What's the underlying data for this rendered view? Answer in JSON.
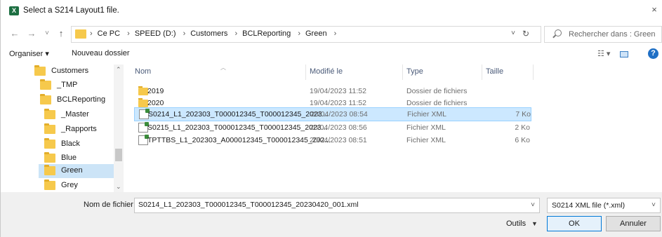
{
  "window": {
    "title": "Select a S214 Layout1 file.",
    "close_glyph": "×"
  },
  "nav": {
    "back_glyph": "←",
    "forward_glyph": "→",
    "recent_glyph": "˅",
    "up_glyph": "↑",
    "address": {
      "crumbs": [
        "Ce PC",
        "SPEED (D:)",
        "Customers",
        "BCLReporting",
        "Green"
      ],
      "separator": "›",
      "dropdown_glyph": "˅"
    },
    "refresh_glyph": "↻",
    "search_placeholder": "Rechercher dans : Green"
  },
  "toolbar": {
    "organiser": "Organiser ▾",
    "new_folder": "Nouveau dossier",
    "views_glyph": "☷ ▾",
    "help_glyph": "?"
  },
  "sidebar": {
    "items": [
      {
        "label": "Customers",
        "selected": false
      },
      {
        "label": "_TMP",
        "selected": false
      },
      {
        "label": "BCLReporting",
        "selected": false
      },
      {
        "label": "_Master",
        "selected": false
      },
      {
        "label": "_Rapports",
        "selected": false
      },
      {
        "label": "Black",
        "selected": false
      },
      {
        "label": "Blue",
        "selected": false
      },
      {
        "label": "Green",
        "selected": true
      },
      {
        "label": "Grey",
        "selected": false
      }
    ]
  },
  "filelist": {
    "columns": {
      "name": "Nom",
      "modified": "Modifié le",
      "type": "Type",
      "size": "Taille"
    },
    "rows": [
      {
        "icon": "folder-icon",
        "name": "2019",
        "modified": "19/04/2023 11:52",
        "type": "Dossier de fichiers",
        "size": "",
        "selected": false
      },
      {
        "icon": "folder-icon",
        "name": "2020",
        "modified": "19/04/2023 11:52",
        "type": "Dossier de fichiers",
        "size": "",
        "selected": false
      },
      {
        "icon": "xml-file-icon",
        "name": "S0214_L1_202303_T000012345_T000012345_2023...",
        "modified": "20/04/2023 08:54",
        "type": "Fichier XML",
        "size": "7 Ko",
        "selected": true
      },
      {
        "icon": "xml-file-icon",
        "name": "S0215_L1_202303_T000012345_T000012345_2023...",
        "modified": "20/04/2023 08:56",
        "type": "Fichier XML",
        "size": "2 Ko",
        "selected": false
      },
      {
        "icon": "xml-file-icon",
        "name": "TPTTBS_L1_202303_A000012345_T000012345_202...",
        "modified": "20/04/2023 08:51",
        "type": "Fichier XML",
        "size": "6 Ko",
        "selected": false
      }
    ]
  },
  "footer": {
    "filename_label": "Nom de fichier :",
    "filename_value": "S0214_L1_202303_T000012345_T000012345_20230420_001.xml",
    "filetype_value": "S0214 XML file  (*.xml)",
    "tools_label": "Outils",
    "ok_label": "OK",
    "cancel_label": "Annuler"
  },
  "colors": {
    "selection": "#cce8ff",
    "selection_border": "#99d1ff",
    "folder": "#f6c94c",
    "accent": "#0078d7"
  }
}
